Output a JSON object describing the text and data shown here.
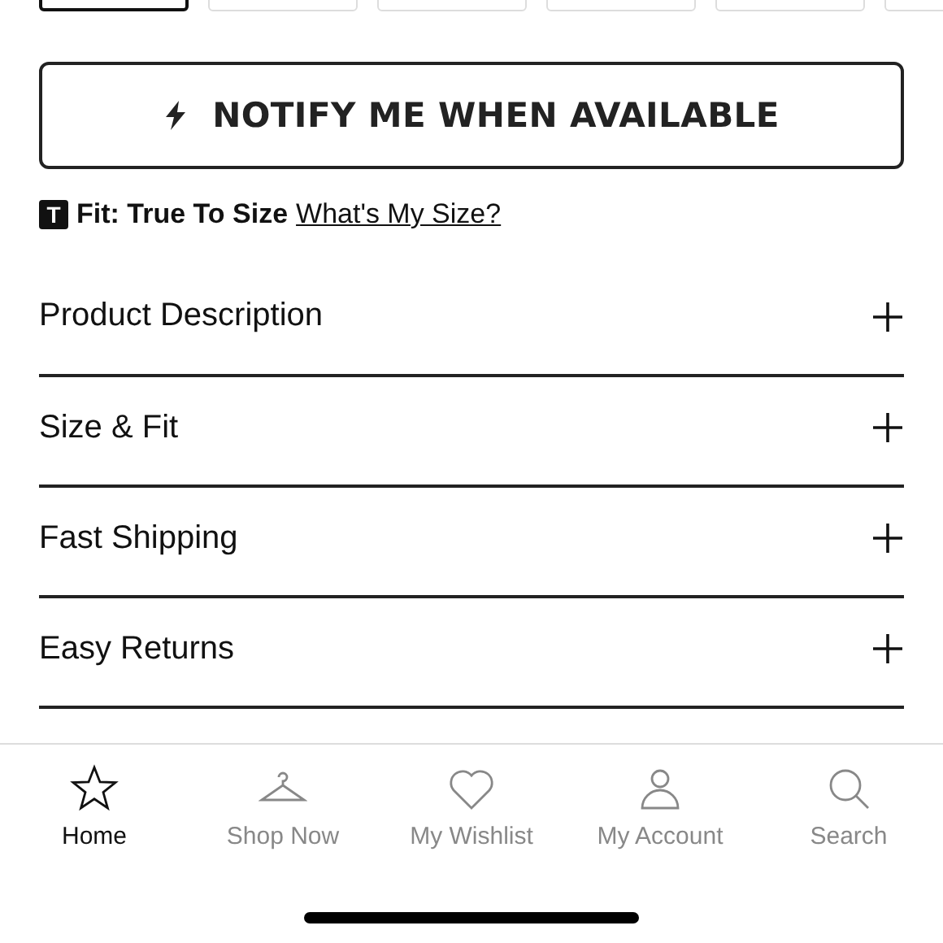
{
  "size_options": [
    {
      "selected": true
    },
    {
      "selected": false
    },
    {
      "selected": false
    },
    {
      "selected": false
    },
    {
      "selected": false
    },
    {
      "selected": false
    }
  ],
  "notify_button": {
    "label": "NOTIFY ME WHEN AVAILABLE"
  },
  "fit": {
    "badge": "T",
    "text": "Fit: True To Size",
    "link": "What's My Size?"
  },
  "accordion": [
    {
      "title": "Product Description",
      "expanded": false
    },
    {
      "title": "Size & Fit",
      "expanded": false
    },
    {
      "title": "Fast Shipping",
      "expanded": false
    },
    {
      "title": "Easy Returns",
      "expanded": false
    }
  ],
  "tab_bar": [
    {
      "label": "Home",
      "kind": "star",
      "selected": true
    },
    {
      "label": "Shop Now",
      "kind": "hanger",
      "selected": false
    },
    {
      "label": "My Wishlist",
      "kind": "heart",
      "selected": false
    },
    {
      "label": "My Account",
      "kind": "person",
      "selected": false
    },
    {
      "label": "Search",
      "kind": "search",
      "selected": false
    }
  ]
}
